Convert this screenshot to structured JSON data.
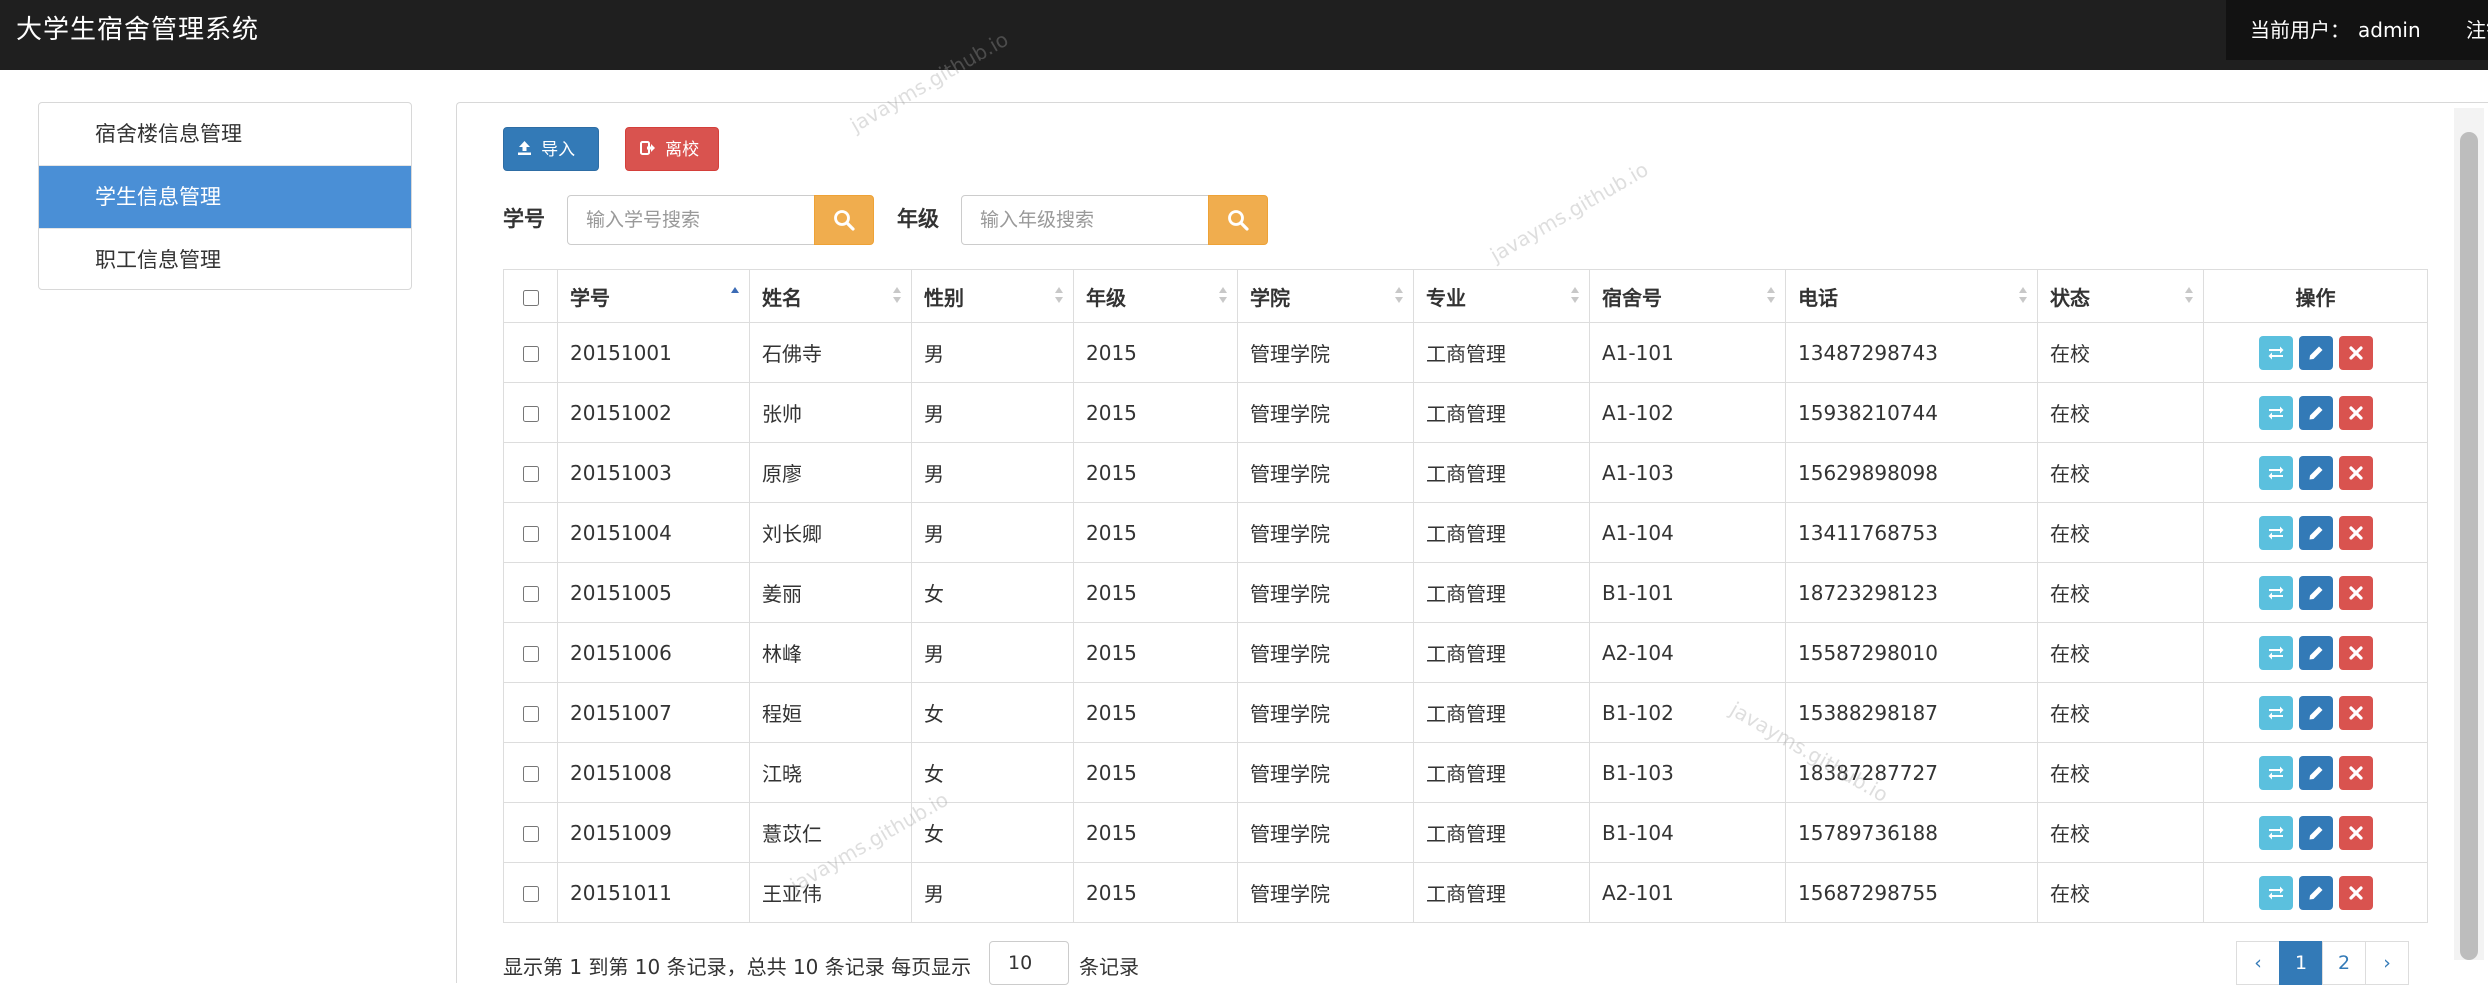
{
  "app": {
    "title": "大学生宿舍管理系统",
    "current_user_label": "当前用户：",
    "current_user": "admin",
    "logout_label": "注销"
  },
  "sidebar": {
    "items": [
      {
        "label": "宿舍楼信息管理",
        "active": false
      },
      {
        "label": "学生信息管理",
        "active": true
      },
      {
        "label": "职工信息管理",
        "active": false
      }
    ]
  },
  "toolbar": {
    "import_label": "导入",
    "leave_label": "离校"
  },
  "search": {
    "student_id_label": "学号",
    "student_id_placeholder": "输入学号搜索",
    "grade_label": "年级",
    "grade_placeholder": "输入年级搜索"
  },
  "table": {
    "columns": [
      "学号",
      "姓名",
      "性别",
      "年级",
      "学院",
      "专业",
      "宿舍号",
      "电话",
      "状态",
      "操作"
    ],
    "rows": [
      [
        "20151001",
        "石佛寺",
        "男",
        "2015",
        "管理学院",
        "工商管理",
        "A1-101",
        "13487298743",
        "在校"
      ],
      [
        "20151002",
        "张帅",
        "男",
        "2015",
        "管理学院",
        "工商管理",
        "A1-102",
        "15938210744",
        "在校"
      ],
      [
        "20151003",
        "原廖",
        "男",
        "2015",
        "管理学院",
        "工商管理",
        "A1-103",
        "15629898098",
        "在校"
      ],
      [
        "20151004",
        "刘长卿",
        "男",
        "2015",
        "管理学院",
        "工商管理",
        "A1-104",
        "13411768753",
        "在校"
      ],
      [
        "20151005",
        "姜丽",
        "女",
        "2015",
        "管理学院",
        "工商管理",
        "B1-101",
        "18723298123",
        "在校"
      ],
      [
        "20151006",
        "林峰",
        "男",
        "2015",
        "管理学院",
        "工商管理",
        "A2-104",
        "15587298010",
        "在校"
      ],
      [
        "20151007",
        "程姮",
        "女",
        "2015",
        "管理学院",
        "工商管理",
        "B1-102",
        "15388298187",
        "在校"
      ],
      [
        "20151008",
        "江晓",
        "女",
        "2015",
        "管理学院",
        "工商管理",
        "B1-103",
        "18387287727",
        "在校"
      ],
      [
        "20151009",
        "薏苡仁",
        "女",
        "2015",
        "管理学院",
        "工商管理",
        "B1-104",
        "15789736188",
        "在校"
      ],
      [
        "20151011",
        "王亚伟",
        "男",
        "2015",
        "管理学院",
        "工商管理",
        "A2-101",
        "15687298755",
        "在校"
      ]
    ]
  },
  "footer": {
    "summary_text": "显示第 1 到第 10 条记录，总共 10 条记录 每页显示",
    "page_size": "10",
    "per_page_suffix": "条记录",
    "pages": [
      "‹",
      "1",
      "2",
      "›"
    ],
    "active_page": "1"
  },
  "watermark": "javayms.github.io",
  "colors": {
    "navbar": "#1f1f1f",
    "sidebar_active": "#4a8fd6",
    "primary": "#337ab7",
    "danger": "#d9534f",
    "warning": "#f0ad4e",
    "info": "#5bc0de"
  },
  "icons": {
    "import": "upload-icon",
    "leave": "sign-out-icon",
    "search": "search-icon",
    "swap": "swap-icon",
    "edit": "pencil-icon",
    "delete": "close-icon"
  }
}
